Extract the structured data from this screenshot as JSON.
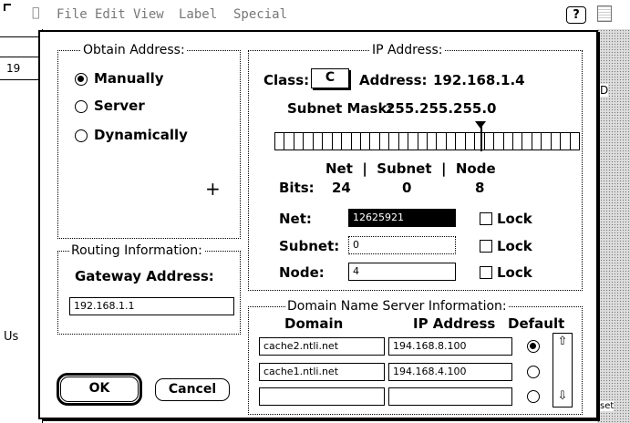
{
  "menubar": {
    "items": [
      "File",
      "Edit",
      "View",
      "Label",
      "Special"
    ]
  },
  "background": {
    "left_fragments": [
      "19",
      "Us"
    ],
    "right_fragments": [
      "D",
      "set"
    ]
  },
  "obtain": {
    "title": "Obtain Address:",
    "options": [
      "Manually",
      "Server",
      "Dynamically"
    ],
    "selected": "Manually"
  },
  "routing": {
    "title": "Routing Information:",
    "gateway_label": "Gateway Address:",
    "gateway_value": "192.168.1.1"
  },
  "ip": {
    "title": "IP Address:",
    "class_label": "Class:",
    "class_value": "C",
    "address_label": "Address:",
    "address_value": "192.168.1.4",
    "mask_label": "Subnet Mask:",
    "mask_value": "255.255.255.0",
    "bits_header": "Net  |  Subnet  |  Node",
    "bits_label": "Bits:",
    "bits_net": "24",
    "bits_subnet": "0",
    "bits_node": "8",
    "slider_position_cell": 24,
    "net_label": "Net:",
    "net_value": "12625921",
    "subnet_label": "Subnet:",
    "subnet_value": "0",
    "node_label": "Node:",
    "node_value": "4",
    "lock_label": "Lock"
  },
  "dns": {
    "title": "Domain Name Server Information:",
    "col_domain": "Domain",
    "col_ip": "IP Address",
    "col_default": "Default",
    "rows": [
      {
        "domain": "cache2.ntli.net",
        "ip": "194.168.8.100",
        "default": true
      },
      {
        "domain": "cache1.ntli.net",
        "ip": "194.168.4.100",
        "default": false
      },
      {
        "domain": "",
        "ip": "",
        "default": false
      }
    ]
  },
  "buttons": {
    "ok": "OK",
    "cancel": "Cancel"
  },
  "icons": {
    "help": "?",
    "apple": "apple-icon",
    "cursor": "+"
  }
}
